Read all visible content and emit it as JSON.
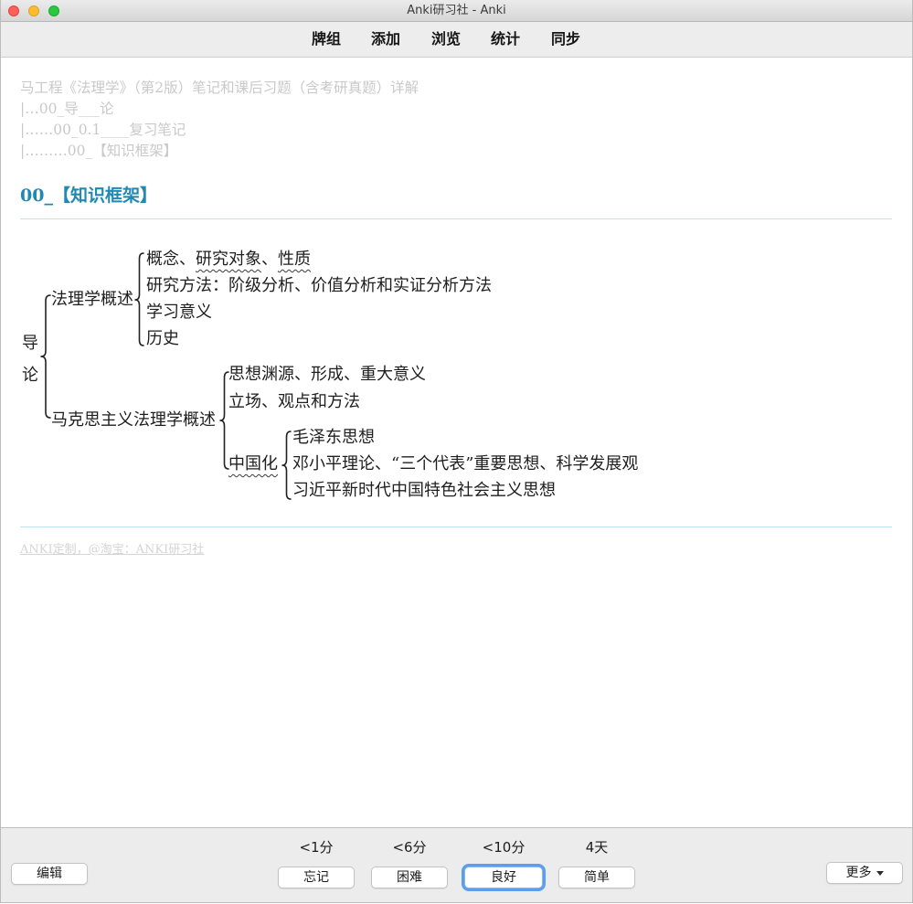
{
  "window": {
    "title": "Anki研习社 - Anki",
    "control_icons": [
      "close-icon",
      "minimize-icon",
      "zoom-icon"
    ]
  },
  "toolbar": {
    "items": [
      "牌组",
      "添加",
      "浏览",
      "统计",
      "同步"
    ]
  },
  "card": {
    "breadcrumb": [
      "马工程《法理学》（第2版）笔记和课后习题（含考研真题）详解",
      "|…00_导___论",
      "|……00_0.1____复习笔记",
      "|………00_【知识框架】"
    ],
    "heading": "00_【知识框架】",
    "diagram": {
      "root": [
        "导",
        "论"
      ],
      "branches": [
        {
          "label": "法理学概述",
          "items": [
            {
              "segments": [
                {
                  "text": "概念、",
                  "wavy": false
                },
                {
                  "text": "研究对象",
                  "wavy": true
                },
                {
                  "text": "、",
                  "wavy": false
                },
                {
                  "text": "性质",
                  "wavy": true
                }
              ]
            },
            {
              "text": "研究方法：阶级分析、价值分析和实证分析方法"
            },
            {
              "text": "学习意义"
            },
            {
              "text": "历史"
            }
          ]
        },
        {
          "label": "马克思主义法理学概述",
          "items": [
            {
              "text": "思想渊源、形成、重大意义"
            },
            {
              "text": "立场、观点和方法"
            },
            {
              "text": "中国化",
              "wavy": true,
              "items": [
                {
                  "text": "毛泽东思想"
                },
                {
                  "text": "邓小平理论、“三个代表”重要思想、科学发展观"
                },
                {
                  "text": "习近平新时代中国特色社会主义思想"
                }
              ]
            }
          ]
        }
      ]
    },
    "footer_link": "ANKI定制，@淘宝：ANKI研习社"
  },
  "reviewer": {
    "edit_label": "编辑",
    "answers": [
      {
        "interval": "<1分",
        "label": "忘记"
      },
      {
        "interval": "<6分",
        "label": "困难"
      },
      {
        "interval": "<10分",
        "label": "良好",
        "focused": true
      },
      {
        "interval": "4天",
        "label": "简单"
      }
    ],
    "more_label": "更多",
    "more_icon": "chevron-down-icon"
  },
  "colors": {
    "heading": "#2189b1",
    "rule": "#bde4f0",
    "muted_text": "#c9c9c9",
    "focus_ring": "#5c9ded"
  }
}
